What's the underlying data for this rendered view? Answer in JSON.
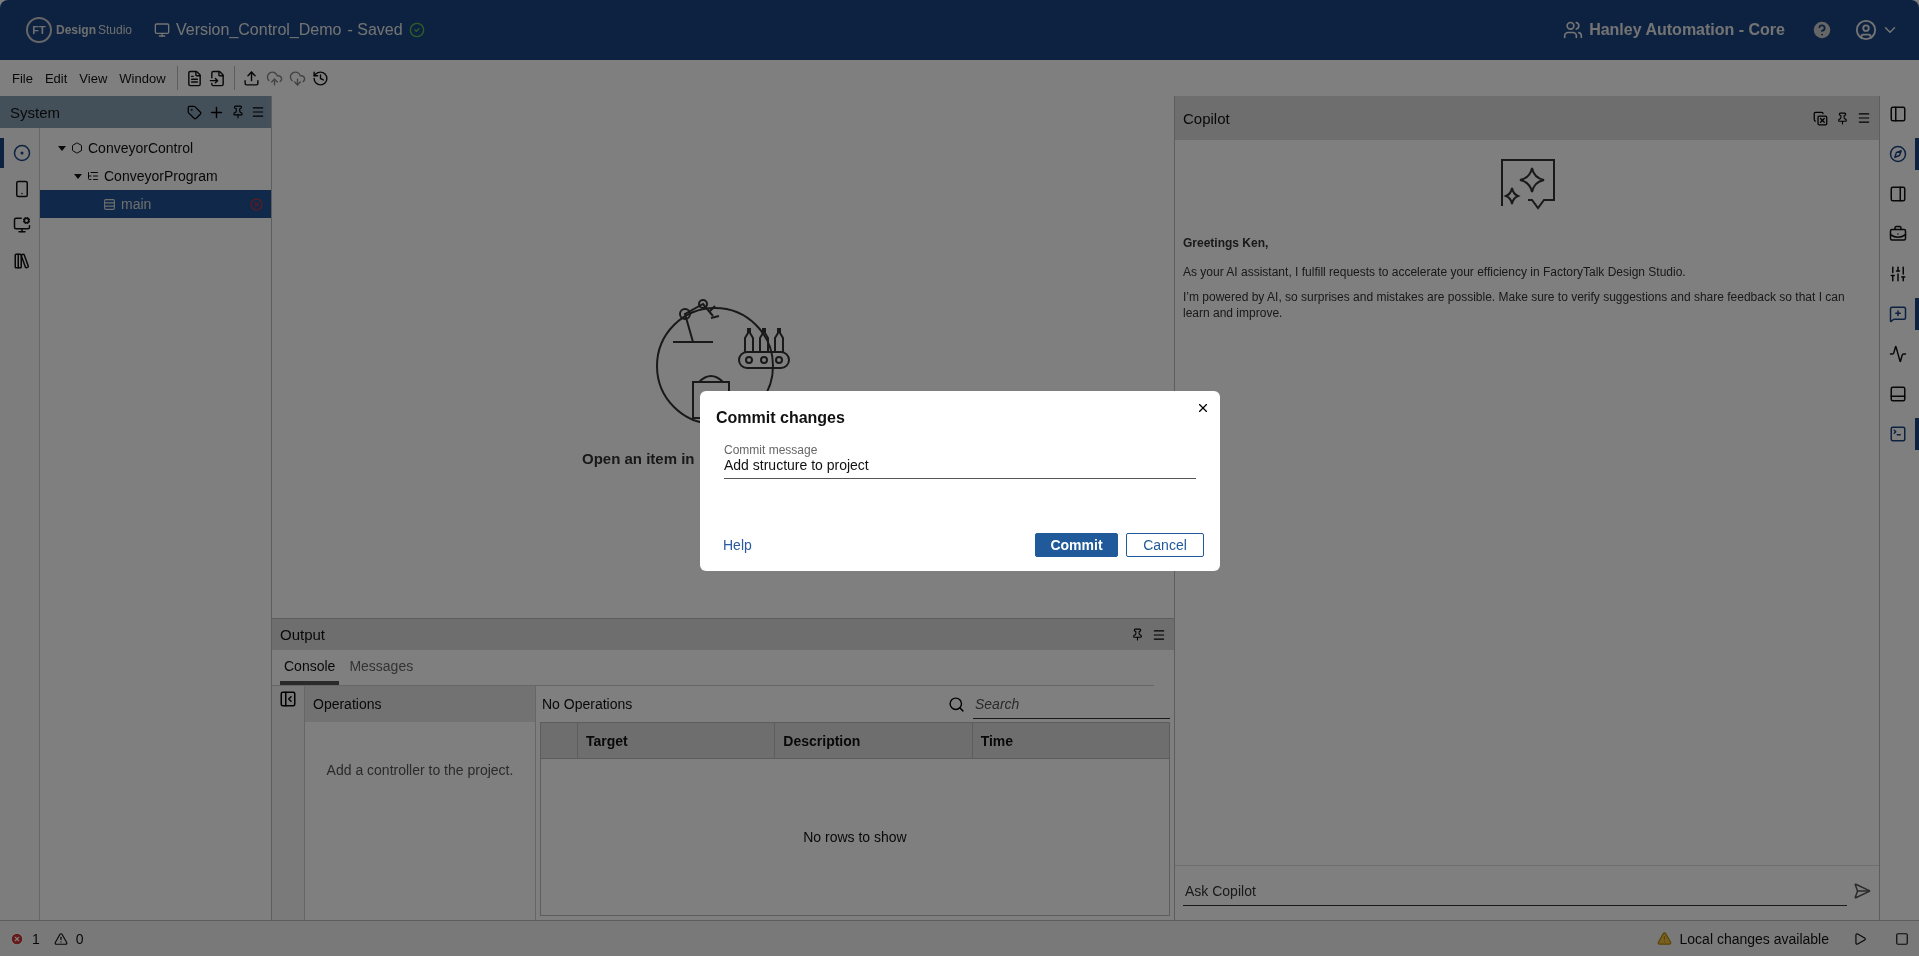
{
  "app": {
    "logo_mark": "FT",
    "logo_bold": "Design",
    "logo_light": "Studio",
    "project": "Version_Control_Demo",
    "save_state": "- Saved",
    "workspace": "Hanley Automation - Core"
  },
  "menu": [
    "File",
    "Edit",
    "View",
    "Window"
  ],
  "left_sidebar": [
    {
      "selected": true
    },
    {
      "selected": false
    },
    {
      "selected": false
    },
    {
      "selected": false
    }
  ],
  "system_panel": {
    "title": "System",
    "tree": [
      {
        "label": "ConveyorControl",
        "kind": "controller",
        "expanded": true,
        "selected": false,
        "error": false,
        "children": [
          {
            "label": "ConveyorProgram",
            "kind": "program",
            "expanded": true,
            "selected": false,
            "error": false,
            "children": [
              {
                "label": "main",
                "kind": "routine",
                "selected": true,
                "error": true
              }
            ]
          }
        ]
      }
    ]
  },
  "editor": {
    "empty_text": "Open an item in"
  },
  "dialog": {
    "title": "Commit changes",
    "field_label": "Commit message",
    "field_value": "Add structure to project",
    "help": "Help",
    "buttons": [
      {
        "label": "Commit",
        "kind": "primary"
      },
      {
        "label": "Cancel",
        "kind": "secondary"
      }
    ]
  },
  "output": {
    "title": "Output",
    "tabs": [
      {
        "label": "Console",
        "selected": true
      },
      {
        "label": "Messages",
        "selected": false
      }
    ],
    "operations_title": "Operations",
    "operations_empty": "Add a controller to the project.",
    "summary": "No Operations",
    "search_placeholder": "Search",
    "columns": [
      "Target",
      "Description",
      "Time"
    ],
    "empty": "No rows to show"
  },
  "copilot": {
    "title": "Copilot",
    "greeting": "Greetings Ken,",
    "paragraphs": [
      "As your AI assistant, I fulfill requests to accelerate your efficiency in FactoryTalk Design Studio.",
      "I’m powered by AI, so surprises and mistakes are possible. Make sure to verify suggestions and share feedback so that I can learn and improve."
    ],
    "input_placeholder": "Ask Copilot"
  },
  "right_toolbar": [
    {
      "selected": false
    },
    {
      "selected": true
    },
    {
      "selected": false
    },
    {
      "selected": false
    },
    {
      "selected": false
    },
    {
      "selected": true
    },
    {
      "selected": false
    },
    {
      "selected": false
    },
    {
      "selected": true
    }
  ],
  "status_bar": {
    "errors": "1",
    "warnings": "0",
    "notice": "Local changes available"
  }
}
